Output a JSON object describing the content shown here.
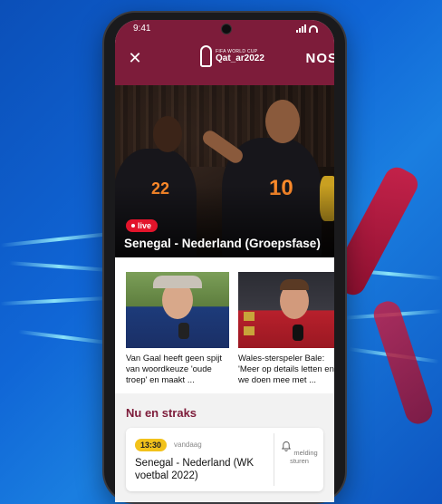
{
  "status_bar": {
    "time": "9:41"
  },
  "header": {
    "close_icon": "close-icon",
    "logo_small": "FIFA WORLD CUP",
    "logo_big": "Qat_ar2022",
    "brand": "NOS"
  },
  "hero": {
    "badge": "live",
    "title": "Senegal - Nederland (Groepsfase)",
    "jersey_left": "22",
    "jersey_right": "10"
  },
  "articles": [
    {
      "title": "Van Gaal heeft geen spijt van woordkeuze 'oude troep' en maakt ..."
    },
    {
      "title": "Wales-sterspeler Bale: 'Meer op details letten en we doen mee met ..."
    }
  ],
  "now_and_later": {
    "heading": "Nu en straks",
    "match": {
      "time": "13:30",
      "day": "vandaag",
      "title": "Senegal - Nederland (WK voetbal 2022)",
      "notify_label": "melding sturen",
      "notify_icon": "bell-icon"
    }
  },
  "colors": {
    "brand": "#7d1c3a",
    "live": "#e3142b",
    "time_badge": "#f2c21b",
    "background": "#1066d6"
  }
}
